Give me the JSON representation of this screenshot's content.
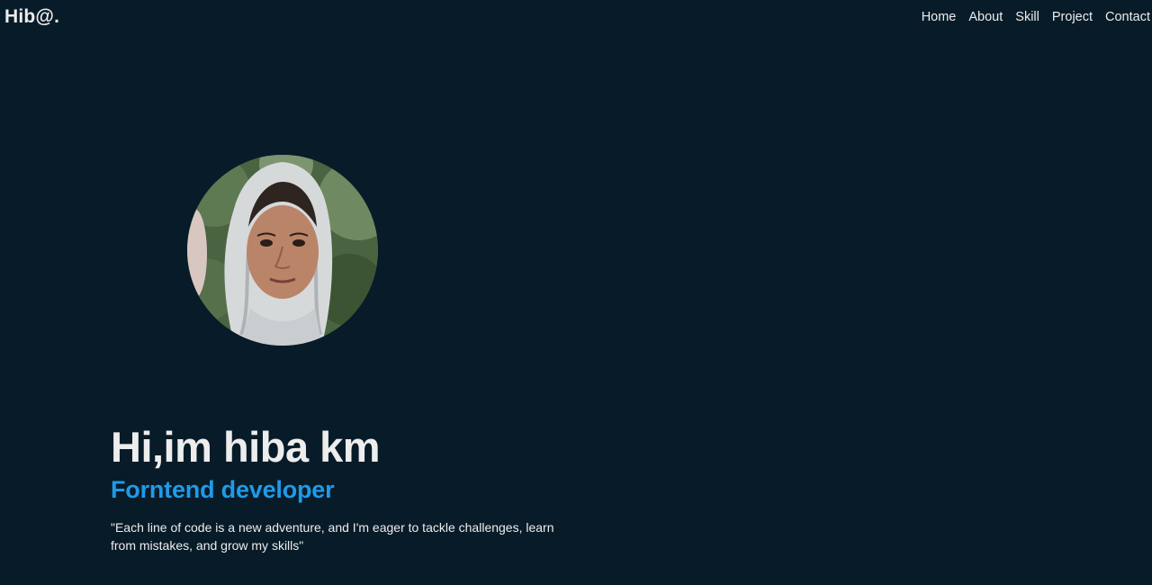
{
  "header": {
    "logo": "Hib@.",
    "nav": [
      {
        "label": "Home"
      },
      {
        "label": "About"
      },
      {
        "label": "Skill"
      },
      {
        "label": "Project"
      },
      {
        "label": "Contact"
      }
    ]
  },
  "hero": {
    "greeting": "Hi,im hiba km",
    "role": "Forntend developer",
    "quote": "\"Each line of code is a new adventure, and I'm eager to tackle challenges, learn from mistakes, and grow my skills\""
  },
  "colors": {
    "background": "#081b29",
    "accent": "#1e9be8",
    "text": "#ededed"
  }
}
